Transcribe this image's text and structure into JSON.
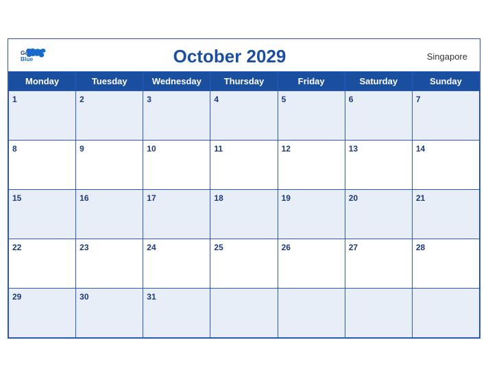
{
  "header": {
    "logo_general": "General",
    "logo_blue": "Blue",
    "month_title": "October 2029",
    "region": "Singapore"
  },
  "weekdays": [
    "Monday",
    "Tuesday",
    "Wednesday",
    "Thursday",
    "Friday",
    "Saturday",
    "Sunday"
  ],
  "weeks": [
    [
      {
        "day": "1",
        "empty": false
      },
      {
        "day": "2",
        "empty": false
      },
      {
        "day": "3",
        "empty": false
      },
      {
        "day": "4",
        "empty": false
      },
      {
        "day": "5",
        "empty": false
      },
      {
        "day": "6",
        "empty": false
      },
      {
        "day": "7",
        "empty": false
      }
    ],
    [
      {
        "day": "8",
        "empty": false
      },
      {
        "day": "9",
        "empty": false
      },
      {
        "day": "10",
        "empty": false
      },
      {
        "day": "11",
        "empty": false
      },
      {
        "day": "12",
        "empty": false
      },
      {
        "day": "13",
        "empty": false
      },
      {
        "day": "14",
        "empty": false
      }
    ],
    [
      {
        "day": "15",
        "empty": false
      },
      {
        "day": "16",
        "empty": false
      },
      {
        "day": "17",
        "empty": false
      },
      {
        "day": "18",
        "empty": false
      },
      {
        "day": "19",
        "empty": false
      },
      {
        "day": "20",
        "empty": false
      },
      {
        "day": "21",
        "empty": false
      }
    ],
    [
      {
        "day": "22",
        "empty": false
      },
      {
        "day": "23",
        "empty": false
      },
      {
        "day": "24",
        "empty": false
      },
      {
        "day": "25",
        "empty": false
      },
      {
        "day": "26",
        "empty": false
      },
      {
        "day": "27",
        "empty": false
      },
      {
        "day": "28",
        "empty": false
      }
    ],
    [
      {
        "day": "29",
        "empty": false
      },
      {
        "day": "30",
        "empty": false
      },
      {
        "day": "31",
        "empty": false
      },
      {
        "day": "",
        "empty": true
      },
      {
        "day": "",
        "empty": true
      },
      {
        "day": "",
        "empty": true
      },
      {
        "day": "",
        "empty": true
      }
    ]
  ]
}
